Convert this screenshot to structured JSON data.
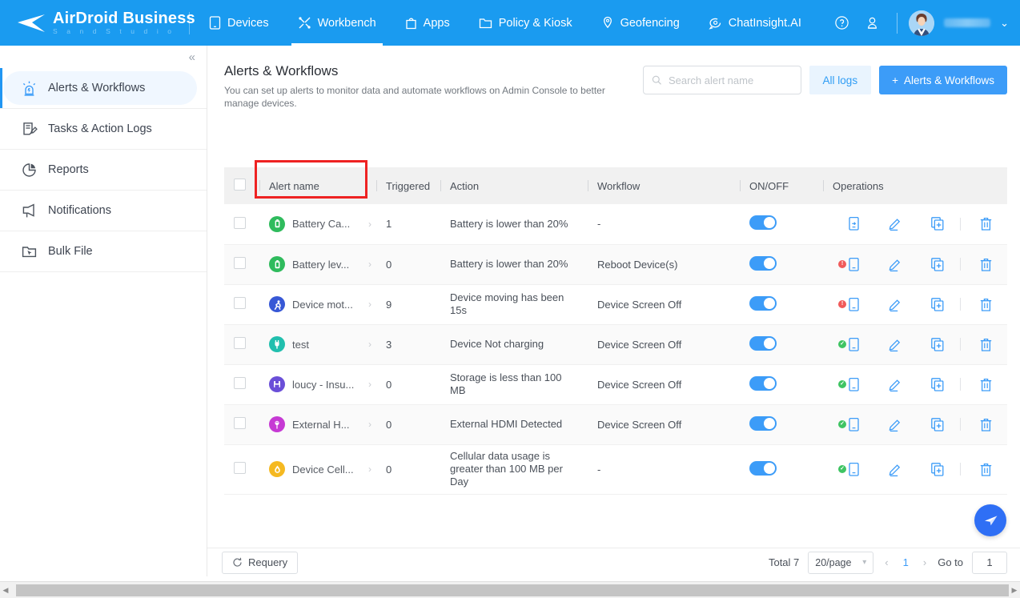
{
  "topnav": {
    "brand_title": "AirDroid Business",
    "brand_sub": "S a n d   S t u d i o",
    "items": [
      {
        "label": "Devices",
        "icon": "device-icon",
        "active": false
      },
      {
        "label": "Workbench",
        "icon": "tools-icon",
        "active": true
      },
      {
        "label": "Apps",
        "icon": "apps-bag-icon",
        "active": false
      },
      {
        "label": "Policy & Kiosk",
        "icon": "folder-icon",
        "active": false
      },
      {
        "label": "Geofencing",
        "icon": "location-pin-icon",
        "active": false
      },
      {
        "label": "ChatInsight.AI",
        "icon": "chat-ai-icon",
        "active": false
      }
    ],
    "help_icon": "help-circle-icon",
    "account_icon": "user-shield-icon",
    "avatar": "avatar",
    "username": "",
    "caret": "⌄"
  },
  "sidebar": {
    "collapse_label": "«",
    "items": [
      {
        "label": "Alerts & Workflows",
        "icon": "alarm-light-icon",
        "active": true
      },
      {
        "label": "Tasks & Action Logs",
        "icon": "task-list-icon",
        "active": false
      },
      {
        "label": "Reports",
        "icon": "pie-chart-icon",
        "active": false
      },
      {
        "label": "Notifications",
        "icon": "megaphone-icon",
        "active": false
      },
      {
        "label": "Bulk File",
        "icon": "folder-cursor-icon",
        "active": false
      }
    ]
  },
  "page": {
    "title": "Alerts & Workflows",
    "description": "You can set up alerts to monitor data and automate workflows on Admin Console to better manage devices."
  },
  "search": {
    "placeholder": "Search alert name",
    "value": "",
    "icon": "search-icon"
  },
  "buttons": {
    "all_logs": "All logs",
    "add_alert": "Alerts & Workflows",
    "add_plus": "+",
    "requery": "Requery"
  },
  "table": {
    "columns": [
      "Alert name",
      "Triggered",
      "Action",
      "Workflow",
      "ON/OFF",
      "Operations"
    ],
    "rows": [
      {
        "name": "Battery Ca...",
        "icon": "battery-icon",
        "icon_color": "#2fbb5d",
        "triggered": "1",
        "triggered_zero": false,
        "action": "Battery is lower than 20%",
        "workflow": "-",
        "on": true,
        "assign_badge": "none",
        "highlight": true
      },
      {
        "name": "Battery lev...",
        "icon": "battery-icon",
        "icon_color": "#2fbb5d",
        "triggered": "0",
        "triggered_zero": true,
        "action": "Battery is lower than 20%",
        "workflow": "Reboot Device(s)",
        "on": true,
        "assign_badge": "error",
        "highlight": false
      },
      {
        "name": "Device mot...",
        "icon": "running-person-icon",
        "icon_color": "#3758d6",
        "triggered": "9",
        "triggered_zero": false,
        "action": "Device moving has been 15s",
        "workflow": "Device Screen Off",
        "on": true,
        "assign_badge": "error",
        "highlight": false
      },
      {
        "name": "test",
        "icon": "plug-icon",
        "icon_color": "#21bfae",
        "triggered": "3",
        "triggered_zero": false,
        "action": "Device Not charging",
        "workflow": "Device Screen Off",
        "on": true,
        "assign_badge": "ok",
        "highlight": false
      },
      {
        "name": "loucy - Insu...",
        "icon": "storage-icon",
        "icon_color": "#6a4fd8",
        "triggered": "0",
        "triggered_zero": true,
        "action": "Storage is less than 100 MB",
        "workflow": "Device Screen Off",
        "on": true,
        "assign_badge": "ok",
        "highlight": false
      },
      {
        "name": "External H...",
        "icon": "usb-hdmi-icon",
        "icon_color": "#c63ad4",
        "triggered": "0",
        "triggered_zero": true,
        "action": "External HDMI Detected",
        "workflow": "Device Screen Off",
        "on": true,
        "assign_badge": "ok",
        "highlight": false
      },
      {
        "name": "Device Cell...",
        "icon": "data-drop-icon",
        "icon_color": "#f5b921",
        "triggered": "0",
        "triggered_zero": true,
        "action": "Cellular data usage is greater than 100 MB per Day",
        "workflow": "-",
        "on": true,
        "assign_badge": "ok",
        "highlight": false
      }
    ],
    "operation_icons": [
      "assign-device-icon",
      "edit-icon",
      "duplicate-icon",
      "delete-icon"
    ]
  },
  "pagination": {
    "total": "Total 7",
    "page_size": "20/page",
    "prev": "‹",
    "next": "›",
    "current_page": "1",
    "goto_label": "Go to",
    "goto_value": "1"
  },
  "fab": {
    "icon": "send-plane-icon"
  },
  "colors": {
    "brand_blue": "#1a9bf0",
    "primary": "#3c9cf8",
    "highlight_red": "#ee2222",
    "toggle_on": "#3c9cf8",
    "fab_blue": "#2f6ff5"
  }
}
